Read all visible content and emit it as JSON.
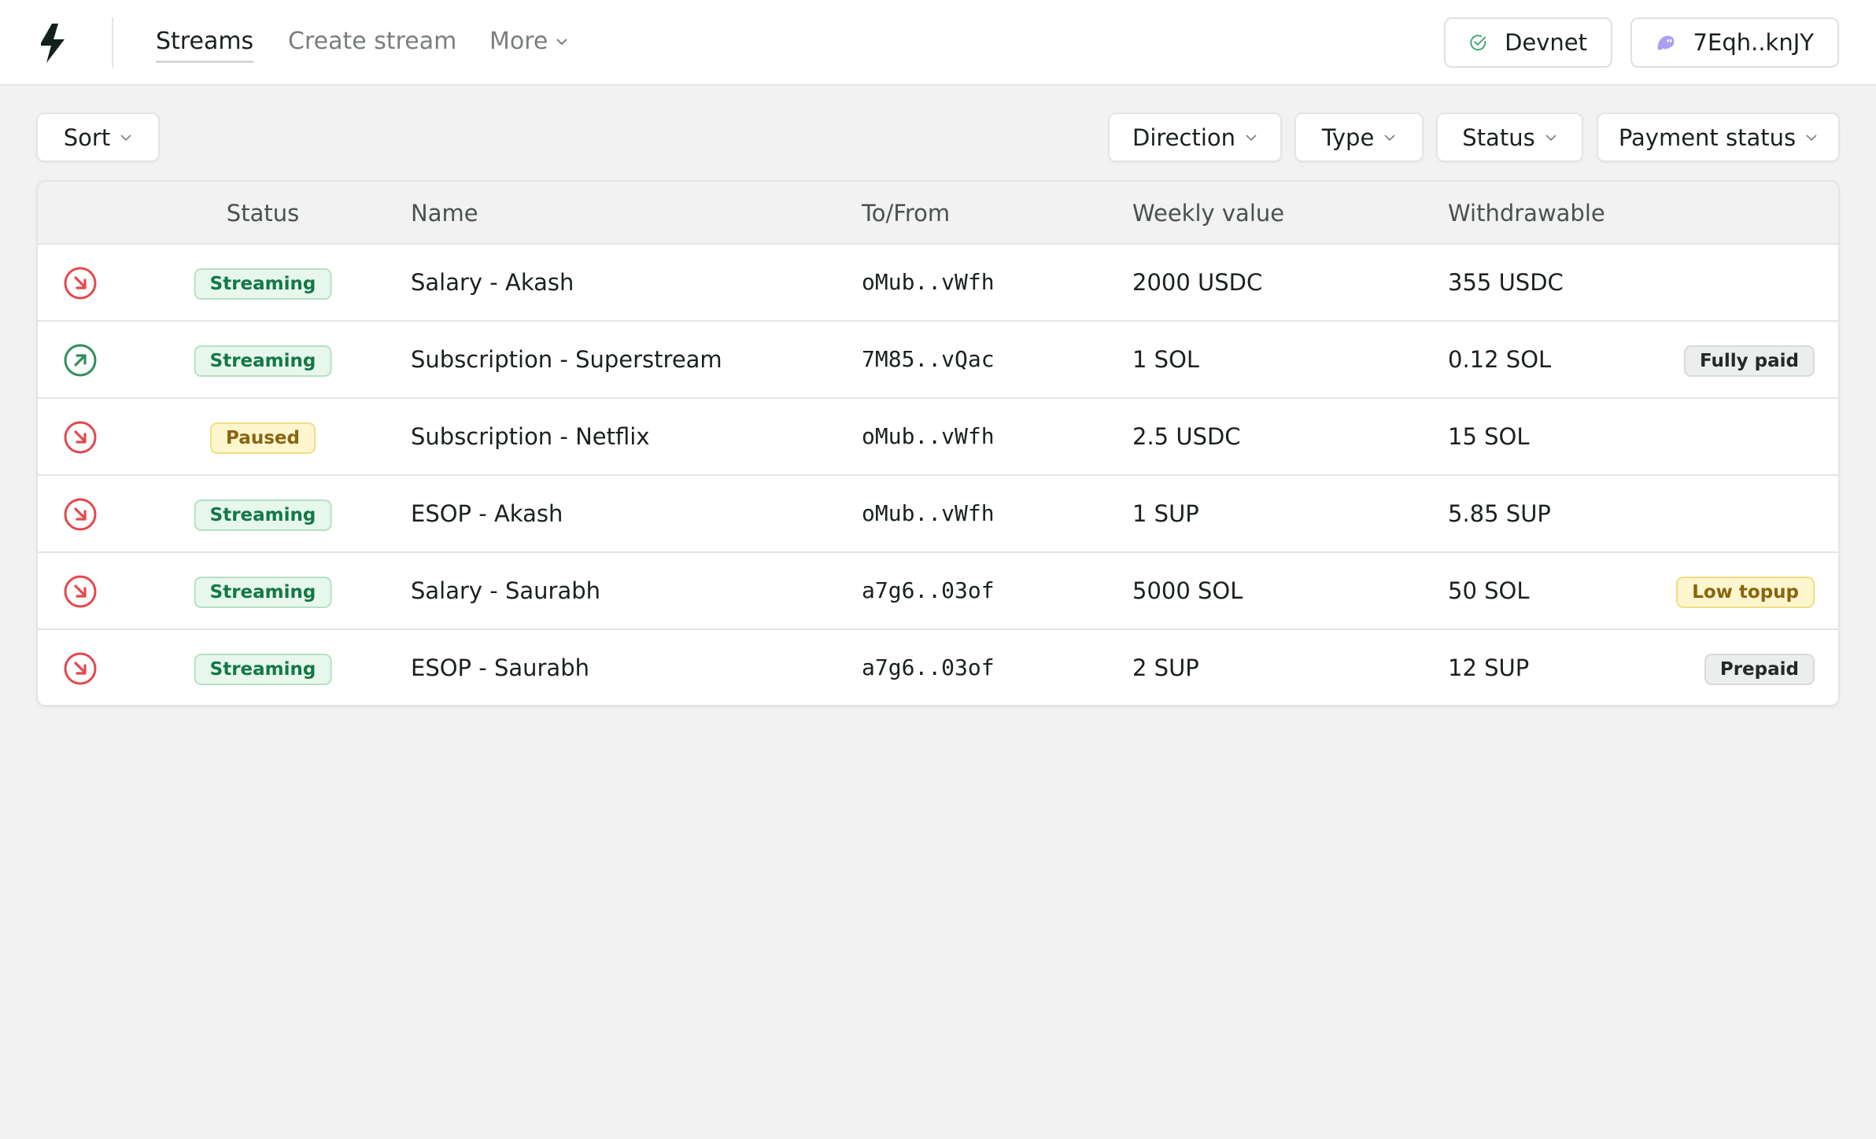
{
  "nav": {
    "items": [
      {
        "label": "Streams",
        "active": true
      },
      {
        "label": "Create stream",
        "active": false
      },
      {
        "label": "More",
        "has_dropdown": true
      }
    ]
  },
  "header": {
    "network_label": "Devnet",
    "network_icon": "check-circle-icon",
    "wallet_label": "7Eqh..knJY",
    "wallet_icon": "phantom-ghost-icon"
  },
  "filters": {
    "sort_label": "Sort",
    "direction_label": "Direction",
    "type_label": "Type",
    "status_label": "Status",
    "payment_status_label": "Payment status"
  },
  "table": {
    "columns": [
      "Status",
      "Name",
      "To/From",
      "Weekly value",
      "Withdrawable"
    ],
    "rows": [
      {
        "direction": "incoming",
        "status": "Streaming",
        "name": "Salary - Akash",
        "to_from": "oMub..vWfh",
        "weekly_value": "2000 USDC",
        "withdrawable": "355 USDC",
        "payment_status": ""
      },
      {
        "direction": "outgoing",
        "status": "Streaming",
        "name": "Subscription - Superstream",
        "to_from": "7M85..vQac",
        "weekly_value": "1 SOL",
        "withdrawable": "0.12 SOL",
        "payment_status": "Fully paid"
      },
      {
        "direction": "incoming",
        "status": "Paused",
        "name": "Subscription - Netflix",
        "to_from": "oMub..vWfh",
        "weekly_value": "2.5 USDC",
        "withdrawable": "15 SOL",
        "payment_status": ""
      },
      {
        "direction": "incoming",
        "status": "Streaming",
        "name": "ESOP - Akash",
        "to_from": "oMub..vWfh",
        "weekly_value": "1 SUP",
        "withdrawable": "5.85 SUP",
        "payment_status": ""
      },
      {
        "direction": "incoming",
        "status": "Streaming",
        "name": "Salary - Saurabh",
        "to_from": "a7g6..03of",
        "weekly_value": "5000 SOL",
        "withdrawable": "50 SOL",
        "payment_status": "Low topup"
      },
      {
        "direction": "incoming",
        "status": "Streaming",
        "name": "ESOP - Saurabh",
        "to_from": "a7g6..03of",
        "weekly_value": "2 SUP",
        "withdrawable": "12 SUP",
        "payment_status": "Prepaid"
      }
    ]
  },
  "colors": {
    "incoming": "#e5484d",
    "outgoing": "#2f8f5b",
    "brand_logo": "#14201a",
    "wallet_ghost": "#ab9ff2",
    "network_ok": "#30a46c"
  }
}
